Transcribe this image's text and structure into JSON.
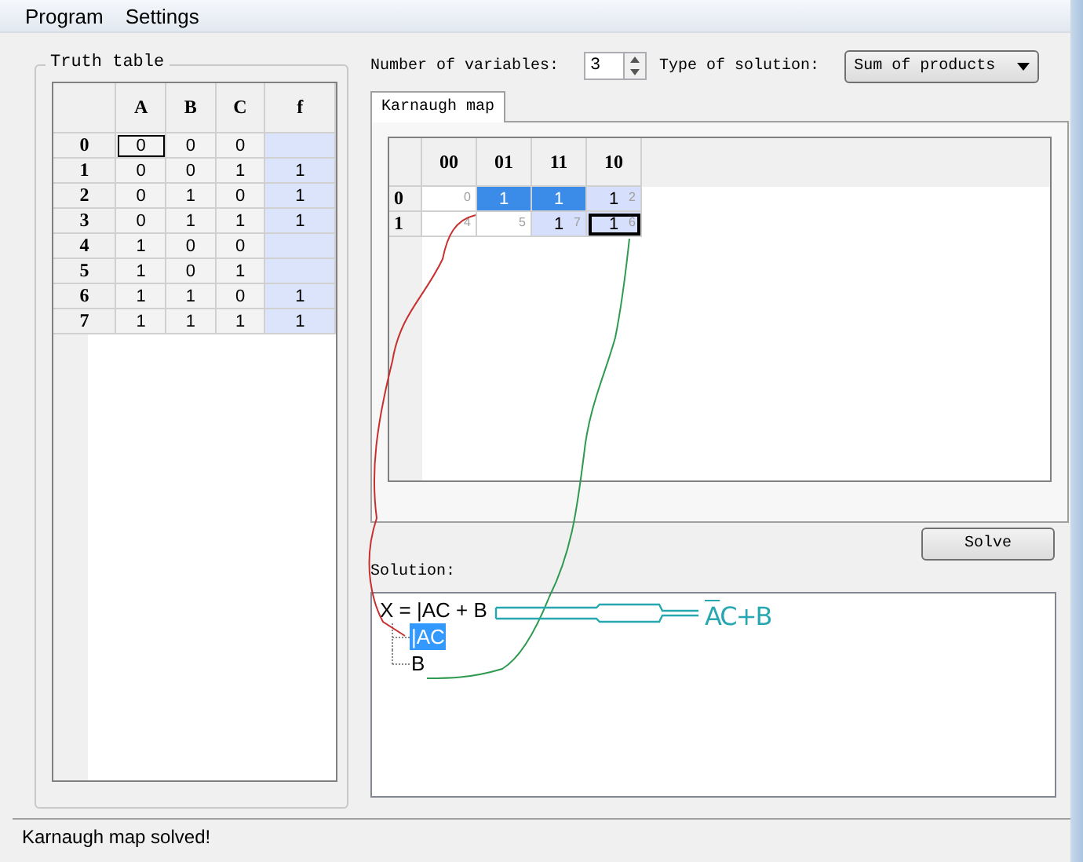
{
  "menu": [
    {
      "label": "Program"
    },
    {
      "label": "Settings"
    }
  ],
  "truth_table": {
    "title": "Truth table",
    "columns": [
      "A",
      "B",
      "C",
      "f"
    ],
    "rows": [
      {
        "label": "0",
        "cells": [
          {
            "text": "0",
            "focused": true
          },
          {
            "text": "0",
            "focused": false
          },
          {
            "text": "0",
            "focused": false
          },
          {
            "focused": false
          }
        ]
      },
      {
        "label": "1",
        "cells": [
          {
            "text": "0",
            "focused": false
          },
          {
            "text": "0",
            "focused": false
          },
          {
            "text": "1",
            "focused": false
          },
          {
            "text": "1",
            "focused": false
          }
        ]
      },
      {
        "label": "2",
        "cells": [
          {
            "text": "0",
            "focused": false
          },
          {
            "text": "1",
            "focused": false
          },
          {
            "text": "0",
            "focused": false
          },
          {
            "text": "1",
            "focused": false
          }
        ]
      },
      {
        "label": "3",
        "cells": [
          {
            "text": "0",
            "focused": false
          },
          {
            "text": "1",
            "focused": false
          },
          {
            "text": "1",
            "focused": false
          },
          {
            "text": "1",
            "focused": false
          }
        ]
      },
      {
        "label": "4",
        "cells": [
          {
            "text": "1",
            "focused": false
          },
          {
            "text": "0",
            "focused": false
          },
          {
            "text": "0",
            "focused": false
          },
          {
            "focused": false
          }
        ]
      },
      {
        "label": "5",
        "cells": [
          {
            "text": "1",
            "focused": false
          },
          {
            "text": "0",
            "focused": false
          },
          {
            "text": "1",
            "focused": false
          },
          {
            "focused": false
          }
        ]
      },
      {
        "label": "6",
        "cells": [
          {
            "text": "1",
            "focused": false
          },
          {
            "text": "1",
            "focused": false
          },
          {
            "text": "0",
            "focused": false
          },
          {
            "text": "1",
            "focused": false
          }
        ]
      },
      {
        "label": "7",
        "cells": [
          {
            "text": "1",
            "focused": false
          },
          {
            "text": "1",
            "focused": false
          },
          {
            "text": "1",
            "focused": false
          },
          {
            "text": "1",
            "focused": false
          }
        ]
      }
    ]
  },
  "variables": {
    "label": "Number of variables:",
    "value": "3"
  },
  "solution_type": {
    "label": "Type of solution:",
    "value": "Sum of products"
  },
  "tabs": [
    {
      "label": "Karnaugh map",
      "selected": true
    }
  ],
  "kmap": {
    "columns": [
      "00",
      "01",
      "11",
      "10"
    ],
    "rows": [
      {
        "label": "0",
        "cells": [
          {
            "index": "0",
            "selected": false,
            "grouped": false,
            "focused": false
          },
          {
            "text": "1",
            "selected": true,
            "grouped": true,
            "focused": false
          },
          {
            "text": "1",
            "selected": true,
            "grouped": true,
            "focused": false
          },
          {
            "text": "1",
            "index": "2",
            "selected": false,
            "grouped": true,
            "focused": false
          }
        ]
      },
      {
        "label": "1",
        "cells": [
          {
            "index": "4",
            "selected": false,
            "grouped": false,
            "focused": false
          },
          {
            "index": "5",
            "selected": false,
            "grouped": false,
            "focused": false
          },
          {
            "text": "1",
            "index": "7",
            "selected": false,
            "grouped": true,
            "focused": false
          },
          {
            "text": "1",
            "index": "6",
            "selected": false,
            "grouped": true,
            "focused": true
          }
        ]
      }
    ]
  },
  "solve_button": {
    "label": "Solve"
  },
  "solution": {
    "label": "Solution:",
    "tree": {
      "text": "X = |AC + B",
      "children": [
        {
          "text": "|AC",
          "selected": true
        },
        {
          "text": "B",
          "selected": false
        }
      ]
    }
  },
  "note": {
    "negated": "A",
    "rest": "C+B"
  },
  "status_bar": {
    "text": "Karnaugh map solved!"
  }
}
